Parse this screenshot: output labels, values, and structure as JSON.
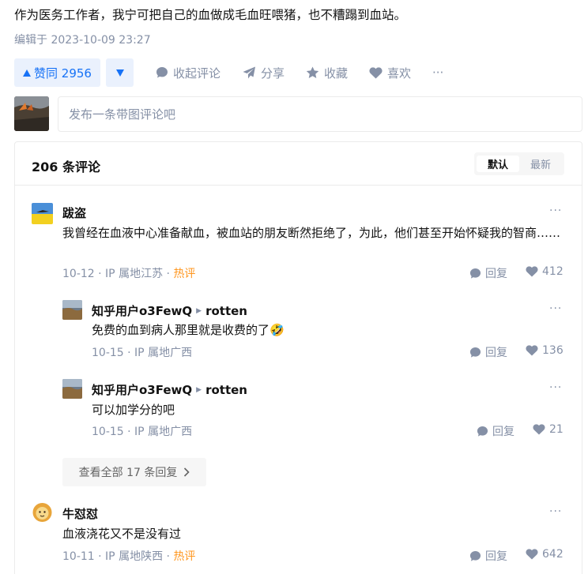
{
  "answer": {
    "text": "作为医务工作者，我宁可把自己的血做成毛血旺喂猪，也不糟蹋到血站。",
    "edit_time": "编辑于 2023-10-09 23:27"
  },
  "actions": {
    "vote_label": "赞同 2956",
    "collapse_label": "收起评论",
    "share_label": "分享",
    "favorite_label": "收藏",
    "like_label": "喜欢",
    "more_label": "···"
  },
  "composer": {
    "placeholder": "发布一条带图评论吧"
  },
  "comments_header": {
    "count": "206 条评论",
    "sort_default": "默认",
    "sort_latest": "最新"
  },
  "comments": [
    {
      "author": "跋盗",
      "text": "我曾经在血液中心准备献血，被血站的朋友断然拒绝了，为此，他们甚至开始怀疑我的智商……",
      "date": "10-12",
      "location": "IP 属地江苏",
      "badge": "热评",
      "reply_label": "回复",
      "likes": "412",
      "replies": [
        {
          "author": "知乎用户o3FewQ",
          "reply_to": "rotten",
          "text": "免费的血到病人那里就是收费的了🤣",
          "date": "10-15",
          "location": "IP 属地广西",
          "reply_label": "回复",
          "likes": "136"
        },
        {
          "author": "知乎用户o3FewQ",
          "reply_to": "rotten",
          "text": "可以加学分的吧",
          "date": "10-15",
          "location": "IP 属地广西",
          "reply_label": "回复",
          "likes": "21"
        }
      ],
      "view_all": "查看全部 17 条回复"
    },
    {
      "author": "牛怼怼",
      "text": "血液浇花又不是没有过",
      "date": "10-11",
      "location": "IP 属地陕西",
      "badge": "热评",
      "reply_label": "回复",
      "likes": "642"
    }
  ],
  "colors": {
    "brand": "#1772f6",
    "brand_bg": "#eaf1fd",
    "muted": "#8590a6",
    "hot": "#ff961e",
    "border": "#ebebeb"
  }
}
